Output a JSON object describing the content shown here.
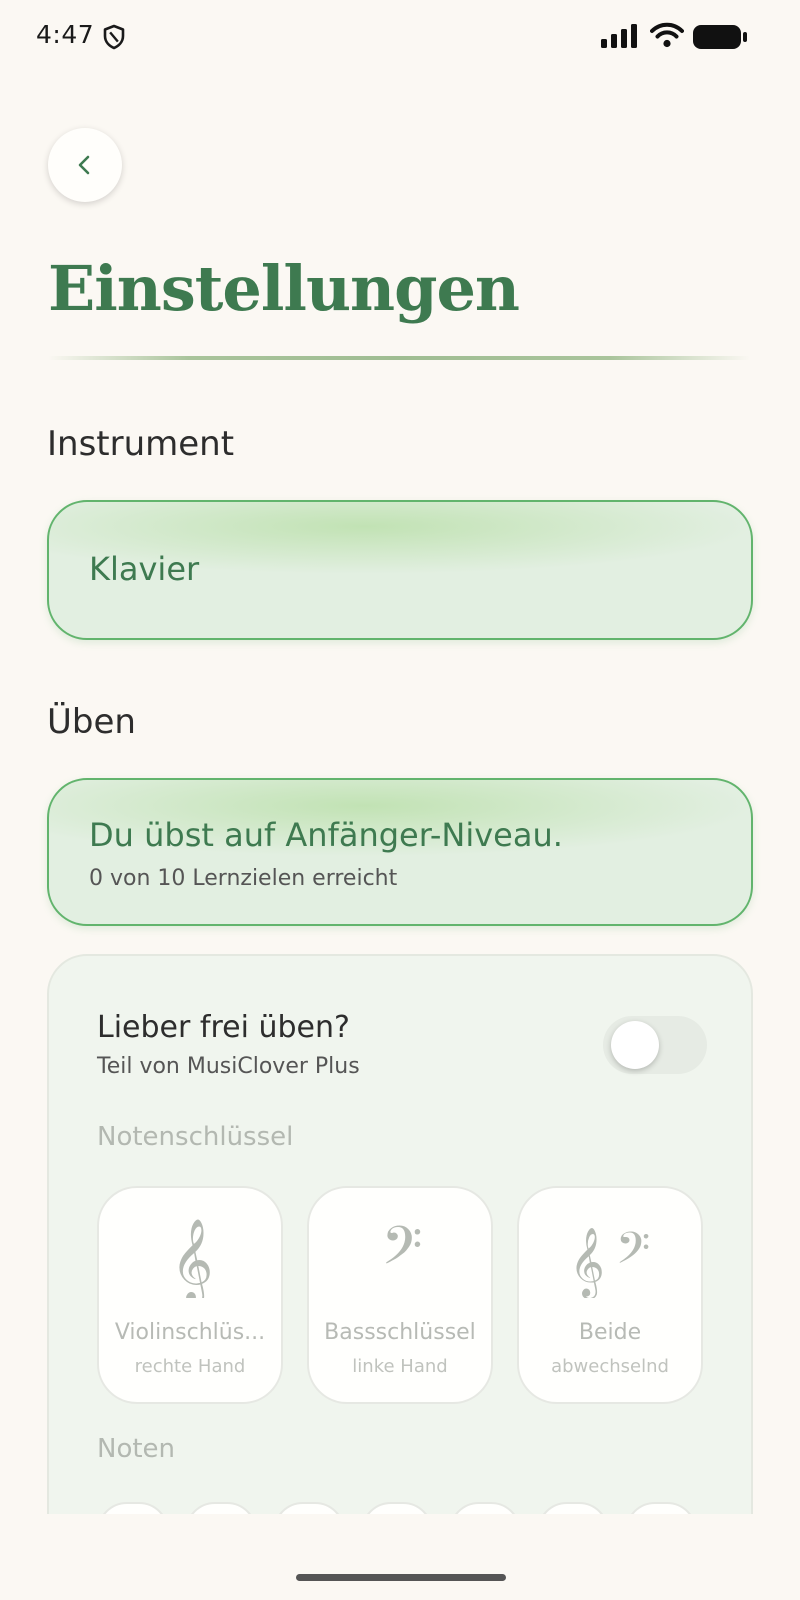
{
  "status_bar": {
    "time": "4:47",
    "icons": [
      "shield-icon",
      "signal-icon",
      "wifi-icon",
      "battery-icon"
    ]
  },
  "header": {
    "back_icon": "chevron-left-icon",
    "title": "Einstellungen"
  },
  "instrument_section": {
    "heading": "Instrument",
    "selected": "Klavier"
  },
  "practice_section": {
    "heading": "Üben",
    "level_title": "Du übst auf Anfänger-Niveau.",
    "level_progress": "0 von 10 Lernzielen erreicht",
    "free_practice": {
      "title": "Lieber frei üben?",
      "subtitle": "Teil von MusiClover Plus",
      "enabled": false
    },
    "clef_heading": "Notenschlüssel",
    "clefs": [
      {
        "icon": "treble-clef-icon",
        "label": "Violinschlüs...",
        "sub": "rechte Hand"
      },
      {
        "icon": "bass-clef-icon",
        "label": "Bassschlüssel",
        "sub": "linke Hand"
      },
      {
        "icon": "both-clefs-icon",
        "label": "Beide",
        "sub": "abwechselnd"
      }
    ],
    "notes_heading": "Noten"
  },
  "colors": {
    "accent_green": "#3e7a50",
    "card_border": "#62b46d",
    "card_fill": "#e2efe1",
    "background": "#fbf8f3"
  }
}
